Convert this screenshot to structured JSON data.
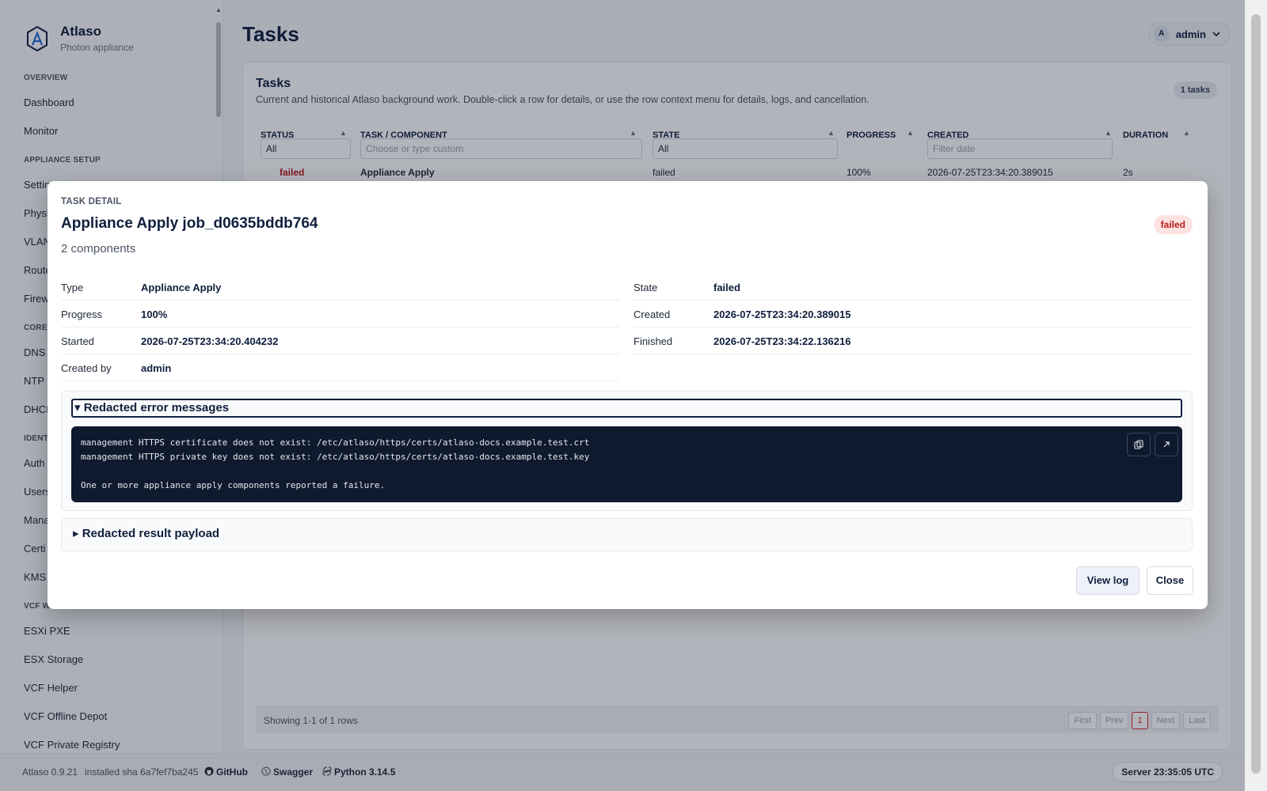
{
  "brand": {
    "name": "Atlaso",
    "subtitle": "Photon appliance"
  },
  "sidebar": {
    "sections": [
      {
        "label": "OVERVIEW",
        "items": [
          "Dashboard",
          "Monitor"
        ]
      },
      {
        "label": "APPLIANCE SETUP",
        "items": [
          "Settings",
          "Physi",
          "VLAN",
          "Route",
          "Firew"
        ]
      },
      {
        "label": "CORE",
        "items": [
          "DNS",
          "NTP",
          "DHCI"
        ]
      },
      {
        "label": "IDENT",
        "items": [
          "Auth",
          "Users",
          "Mana",
          "Certi",
          "KMS"
        ]
      },
      {
        "label": "VCF W",
        "items": [
          "ESXi PXE",
          "ESX Storage",
          "VCF Helper",
          "VCF Offline Depot",
          "VCF Private Registry"
        ]
      }
    ]
  },
  "header": {
    "title": "Tasks",
    "user_initial": "A",
    "user_name": "admin"
  },
  "card": {
    "title": "Tasks",
    "description": "Current and historical Atlaso background work. Double-click a row for details, or use the row context menu for details, logs, and cancellation.",
    "count_badge": "1 tasks"
  },
  "table": {
    "columns": [
      "STATUS",
      "TASK / COMPONENT",
      "STATE",
      "PROGRESS",
      "CREATED",
      "DURATION"
    ],
    "filters": {
      "status_value": "All",
      "task_placeholder": "Choose or type custom",
      "state_value": "All",
      "created_placeholder": "Filter date"
    },
    "rows": [
      {
        "status": "failed",
        "task": "Appliance Apply",
        "state": "failed",
        "progress": "100%",
        "created": "2026-07-25T23:34:20.389015",
        "duration": "2s"
      }
    ],
    "footer": "Showing 1-1 of 1 rows",
    "pager": [
      "First",
      "Prev",
      "1",
      "Next",
      "Last"
    ]
  },
  "statusbar": {
    "version": "Atlaso 0.9.21",
    "sha": "installed sha 6a7fef7ba245",
    "github": "GitHub",
    "swagger": "Swagger",
    "python": "Python 3.14.5",
    "server_time": "Server 23:35:05 UTC"
  },
  "modal": {
    "kicker": "TASK DETAIL",
    "title": "Appliance Apply job_d0635bddb764",
    "subtitle": "2 components",
    "badge": "failed",
    "left": [
      {
        "k": "Type",
        "v": "Appliance Apply"
      },
      {
        "k": "Progress",
        "v": "100%"
      },
      {
        "k": "Started",
        "v": "2026-07-25T23:34:20.404232"
      },
      {
        "k": "Created by",
        "v": "admin"
      }
    ],
    "right": [
      {
        "k": "State",
        "v": "failed"
      },
      {
        "k": "Created",
        "v": "2026-07-25T23:34:20.389015"
      },
      {
        "k": "Finished",
        "v": "2026-07-25T23:34:22.136216"
      }
    ],
    "errors_summary": "▾ Redacted error messages",
    "error_lines": [
      "management HTTPS certificate does not exist: /etc/atlaso/https/certs/atlaso-docs.example.test.crt",
      "management HTTPS private key does not exist: /etc/atlaso/https/certs/atlaso-docs.example.test.key",
      "",
      "One or more appliance apply components reported a failure."
    ],
    "result_summary": "▸ Redacted result payload",
    "view_log": "View log",
    "close": "Close"
  },
  "colors": {
    "accent": "#0f1f3d",
    "danger": "#b91c1c",
    "code_bg": "#0f1a2e"
  }
}
